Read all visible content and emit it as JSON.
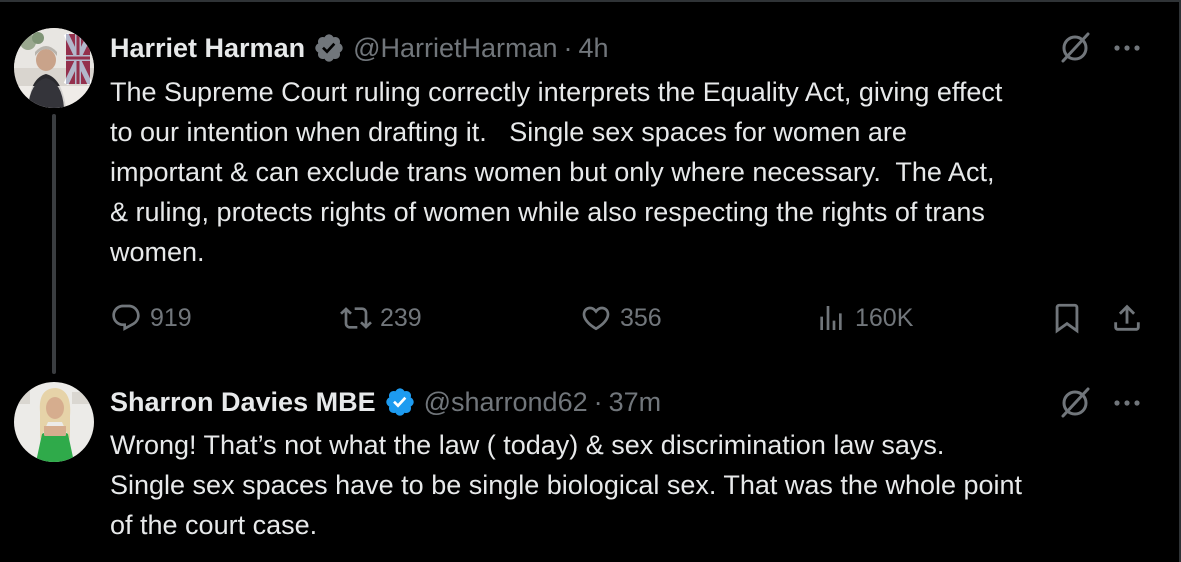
{
  "tweets": [
    {
      "author": "Harriet Harman",
      "handle": "@HarrietHarman",
      "separator": "·",
      "time": "4h",
      "text": "The Supreme Court ruling correctly interprets the Equality Act, giving effect\nto our intention when drafting it.   Single sex spaces for women are\nimportant & can exclude trans women but only where necessary.  The Act,\n& ruling, protects rights of women while also respecting the rights of trans\nwomen.",
      "verified_badge_color": "#71767b",
      "metrics": {
        "replies": "919",
        "reposts": "239",
        "likes": "356",
        "views": "160K"
      }
    },
    {
      "author": "Sharron Davies MBE",
      "handle": "@sharrond62",
      "separator": "·",
      "time": "37m",
      "text": "Wrong! That’s not what the law ( today) & sex discrimination law says.\nSingle sex spaces have to be single biological sex. That was the whole point\nof the court case.",
      "verified_badge_color": "#1d9bf0"
    }
  ],
  "icons": {
    "verified": "verified-badge-icon",
    "grok": "grok-icon",
    "more": "more-icon",
    "reply": "reply-icon",
    "repost": "repost-icon",
    "like": "heart-icon",
    "views": "views-icon",
    "bookmark": "bookmark-icon",
    "share": "share-icon"
  },
  "colors": {
    "background": "#000000",
    "text": "#e7e9ea",
    "muted": "#71767b",
    "accent": "#1d9bf0"
  }
}
